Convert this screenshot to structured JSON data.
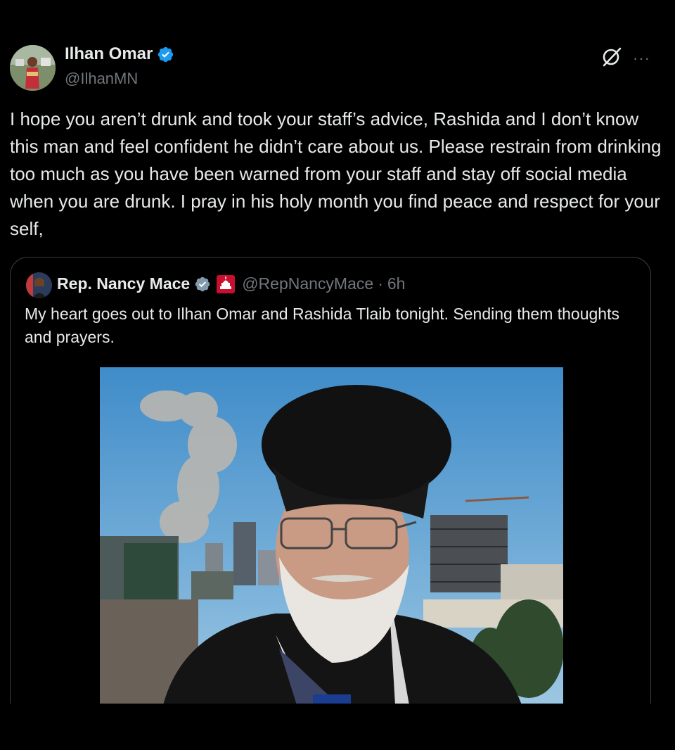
{
  "author": {
    "name": "Ilhan Omar",
    "handle": "@IlhanMN",
    "avatar_icon": "user-avatar-photo",
    "verified_icon": "verified-badge-icon",
    "verified_color": "#1d9bf0"
  },
  "header_actions": {
    "grok_icon": "grok-icon",
    "more_label": "···"
  },
  "tweet": {
    "text": "I hope you aren’t drunk and took your staff’s advice, Rashida and I don’t know this man and feel confident he didn’t care about us. Please restrain from drinking too much as you have been warned from your staff and stay off social media when you are drunk. I pray in his holy month you find peace and respect for your self,"
  },
  "quoted_tweet": {
    "name": "Rep. Nancy Mace",
    "handle": "@RepNancyMace",
    "separator": "·",
    "time": "6h",
    "verified_icon": "verified-gray-badge-icon",
    "verified_color": "#829aab",
    "flag_icon": "us-capitol-government-badge-icon",
    "text": "My heart goes out to Ilhan Omar and Rashida Tlaib tonight. Sending them thoughts and prayers.",
    "image_icon": "news-photo-cleric-city-smoke"
  },
  "colors": {
    "background": "#000000",
    "text_primary": "#e7e9ea",
    "text_secondary": "#71767b",
    "border": "#3a3d41"
  }
}
